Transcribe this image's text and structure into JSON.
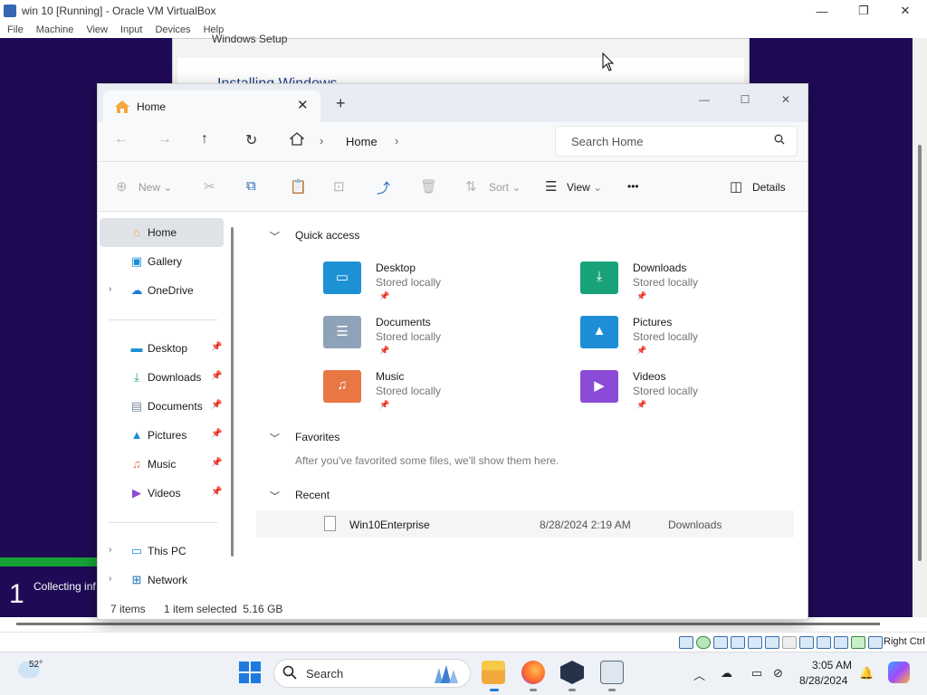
{
  "host": {
    "title": "win 10 [Running] - Oracle VM VirtualBox",
    "menu": [
      "File",
      "Machine",
      "View",
      "Input",
      "Devices",
      "Help"
    ],
    "host_key": "Right Ctrl"
  },
  "vm": {
    "setup_title": "Windows Setup",
    "setup_heading": "Installing Windows",
    "step_num": "1",
    "step_text": "Collecting inf"
  },
  "explorer": {
    "tab_label": "Home",
    "address": "Home",
    "search_placeholder": "Search Home",
    "cmd": {
      "new": "New",
      "sort": "Sort",
      "view": "View",
      "more": "•••",
      "details": "Details"
    },
    "sidebar": {
      "top": [
        {
          "label": "Home",
          "icon": "home-icon"
        },
        {
          "label": "Gallery",
          "icon": "gallery-icon"
        },
        {
          "label": "OneDrive",
          "icon": "cloud-icon"
        }
      ],
      "pinned": [
        {
          "label": "Desktop",
          "icon": "desktop-icon"
        },
        {
          "label": "Downloads",
          "icon": "download-icon"
        },
        {
          "label": "Documents",
          "icon": "document-icon"
        },
        {
          "label": "Pictures",
          "icon": "picture-icon"
        },
        {
          "label": "Music",
          "icon": "music-icon"
        },
        {
          "label": "Videos",
          "icon": "video-icon"
        }
      ],
      "bottom": [
        {
          "label": "This PC",
          "icon": "computer-icon"
        },
        {
          "label": "Network",
          "icon": "network-icon"
        }
      ]
    },
    "sections": {
      "quick_access": "Quick access",
      "favorites": "Favorites",
      "favorites_empty": "After you've favorited some files, we'll show them here.",
      "recent": "Recent"
    },
    "quick_access": [
      {
        "name": "Desktop",
        "status": "Stored locally",
        "color": "#1e90d6",
        "icon": "desktop-folder-icon"
      },
      {
        "name": "Downloads",
        "status": "Stored locally",
        "color": "#19a27a",
        "icon": "downloads-folder-icon"
      },
      {
        "name": "Documents",
        "status": "Stored locally",
        "color": "#8fa3b8",
        "icon": "documents-folder-icon"
      },
      {
        "name": "Pictures",
        "status": "Stored locally",
        "color": "#1e8fd6",
        "icon": "pictures-folder-icon"
      },
      {
        "name": "Music",
        "status": "Stored locally",
        "color": "#e87744",
        "icon": "music-folder-icon"
      },
      {
        "name": "Videos",
        "status": "Stored locally",
        "color": "#8c4bd6",
        "icon": "videos-folder-icon"
      }
    ],
    "recent": [
      {
        "name": "Win10Enterprise",
        "date": "8/28/2024 2:19 AM",
        "location": "Downloads"
      }
    ],
    "status": {
      "items": "7 items",
      "selected": "1 item selected  5.16 GB"
    }
  },
  "taskbar": {
    "weather_temp": "52°",
    "search": "Search",
    "time": "3:05 AM",
    "date": "8/28/2024"
  }
}
